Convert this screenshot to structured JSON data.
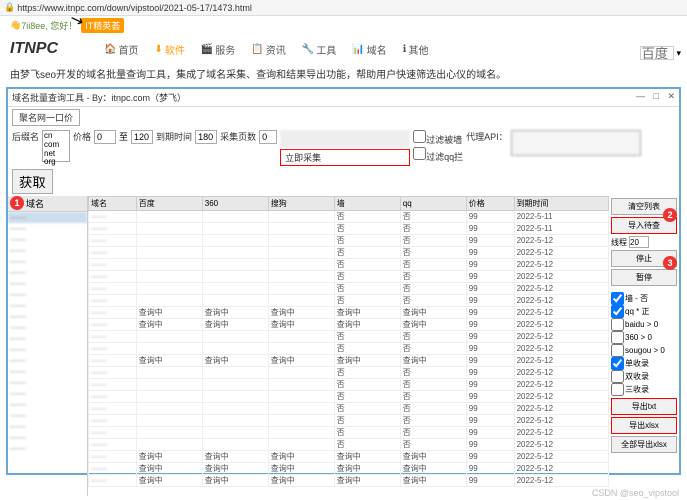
{
  "url": "https://www.itnpc.com/down/vipstool/2021-05-17/1473.html",
  "greeting": "7ii8ee, 您好！",
  "tag": "IT精英荟",
  "logo": "ITNPC",
  "nav": [
    {
      "icon": "🏠",
      "label": "首页"
    },
    {
      "icon": "⬇",
      "label": "软件"
    },
    {
      "icon": "🎬",
      "label": "服务"
    },
    {
      "icon": "📋",
      "label": "资讯"
    },
    {
      "icon": "🔧",
      "label": "工具"
    },
    {
      "icon": "📊",
      "label": "域名"
    },
    {
      "icon": "ℹ",
      "label": "其他"
    }
  ],
  "search_ph": "百度",
  "desc": "由梦飞seo开发的域名批量查询工具，集成了域名采集、查询和结果导出功能，帮助用户快速筛选出心仪的域名。",
  "app_title": "域名批量查询工具 - By：itnpc.com（梦飞）",
  "tab": "聚名网一口价",
  "filters": {
    "suffix_label": "后缀名",
    "suffix": "cn\ncom\nnet\norg",
    "price_label": "价格",
    "price_from": "0",
    "price_to": "120",
    "expire_label": "到期时间",
    "expire": "180",
    "page_label": "采集页数",
    "page": "0",
    "collect": "立即采集",
    "cb1": "过滤被墙",
    "cb2": "过滤qq拦",
    "proxy_label": "代理API：",
    "get": "获取"
  },
  "left_header": "域名",
  "left_items": [
    "——",
    "——",
    "——",
    "——",
    "——",
    "——",
    "——",
    "——",
    "——",
    "——",
    "——",
    "——",
    "——",
    "——",
    "——",
    "——",
    "——",
    "——",
    "——",
    "——",
    "——",
    "——"
  ],
  "columns": [
    "域名",
    "百度",
    "360",
    "搜狗",
    "墙",
    "qq",
    "价格",
    "到期时间"
  ],
  "rows": [
    {
      "d": "——",
      "b": "",
      "s": "",
      "g": "",
      "w": "否",
      "q": "否",
      "p": "99",
      "t": "2022-5-11"
    },
    {
      "d": "——",
      "b": "",
      "s": "",
      "g": "",
      "w": "否",
      "q": "否",
      "p": "99",
      "t": "2022-5-11"
    },
    {
      "d": "——",
      "b": "",
      "s": "",
      "g": "",
      "w": "否",
      "q": "否",
      "p": "99",
      "t": "2022-5-12"
    },
    {
      "d": "——",
      "b": "",
      "s": "",
      "g": "",
      "w": "否",
      "q": "否",
      "p": "99",
      "t": "2022-5-12"
    },
    {
      "d": "——",
      "b": "",
      "s": "",
      "g": "",
      "w": "否",
      "q": "否",
      "p": "99",
      "t": "2022-5-12"
    },
    {
      "d": "——",
      "b": "",
      "s": "",
      "g": "",
      "w": "否",
      "q": "否",
      "p": "99",
      "t": "2022-5-12"
    },
    {
      "d": "——",
      "b": "",
      "s": "",
      "g": "",
      "w": "否",
      "q": "否",
      "p": "99",
      "t": "2022-5-12"
    },
    {
      "d": "——",
      "b": "",
      "s": "",
      "g": "",
      "w": "否",
      "q": "否",
      "p": "99",
      "t": "2022-5-12"
    },
    {
      "d": "——",
      "b": "查询中",
      "s": "查询中",
      "g": "查询中",
      "w": "查询中",
      "q": "查询中",
      "p": "99",
      "t": "2022-5-12"
    },
    {
      "d": "——",
      "b": "查询中",
      "s": "查询中",
      "g": "查询中",
      "w": "查询中",
      "q": "查询中",
      "p": "99",
      "t": "2022-5-12"
    },
    {
      "d": "——",
      "b": "",
      "s": "",
      "g": "",
      "w": "否",
      "q": "否",
      "p": "99",
      "t": "2022-5-12"
    },
    {
      "d": "——",
      "b": "",
      "s": "",
      "g": "",
      "w": "否",
      "q": "否",
      "p": "99",
      "t": "2022-5-12"
    },
    {
      "d": "——",
      "b": "查询中",
      "s": "查询中",
      "g": "查询中",
      "w": "查询中",
      "q": "查询中",
      "p": "99",
      "t": "2022-5-12"
    },
    {
      "d": "——",
      "b": "",
      "s": "",
      "g": "",
      "w": "否",
      "q": "否",
      "p": "99",
      "t": "2022-5-12"
    },
    {
      "d": "——",
      "b": "",
      "s": "",
      "g": "",
      "w": "否",
      "q": "否",
      "p": "99",
      "t": "2022-5-12"
    },
    {
      "d": "——",
      "b": "",
      "s": "",
      "g": "",
      "w": "否",
      "q": "否",
      "p": "99",
      "t": "2022-5-12"
    },
    {
      "d": "——",
      "b": "",
      "s": "",
      "g": "",
      "w": "否",
      "q": "否",
      "p": "99",
      "t": "2022-5-12"
    },
    {
      "d": "——",
      "b": "",
      "s": "",
      "g": "",
      "w": "否",
      "q": "否",
      "p": "99",
      "t": "2022-5-12"
    },
    {
      "d": "——",
      "b": "",
      "s": "",
      "g": "",
      "w": "否",
      "q": "否",
      "p": "99",
      "t": "2022-5-12"
    },
    {
      "d": "——",
      "b": "",
      "s": "",
      "g": "",
      "w": "否",
      "q": "否",
      "p": "99",
      "t": "2022-5-12"
    },
    {
      "d": "——",
      "b": "查询中",
      "s": "查询中",
      "g": "查询中",
      "w": "查询中",
      "q": "查询中",
      "p": "99",
      "t": "2022-5-12"
    },
    {
      "d": "——",
      "b": "查询中",
      "s": "查询中",
      "g": "查询中",
      "w": "查询中",
      "q": "查询中",
      "p": "99",
      "t": "2022-5-12"
    },
    {
      "d": "——",
      "b": "查询中",
      "s": "查询中",
      "g": "查询中",
      "w": "查询中",
      "q": "查询中",
      "p": "99",
      "t": "2022-5-12"
    }
  ],
  "right": {
    "clear": "清空列表",
    "import": "导入待查",
    "thread_label": "线程",
    "thread": "20",
    "stop": "停止",
    "pause": "暂停",
    "chk1": "墙 - 否",
    "chk2": "qq * 正",
    "chk3": "baidu > 0",
    "chk4": "360 > 0",
    "chk5": "sougou > 0",
    "chk6": "单收录",
    "chk7": "双收录",
    "chk8": "三收录",
    "exp_txt": "导出txt",
    "exp_xlsx": "导出xlsx",
    "exp_all": "全部导出xlsx"
  },
  "watermark": "CSDN @seo_vipstool"
}
